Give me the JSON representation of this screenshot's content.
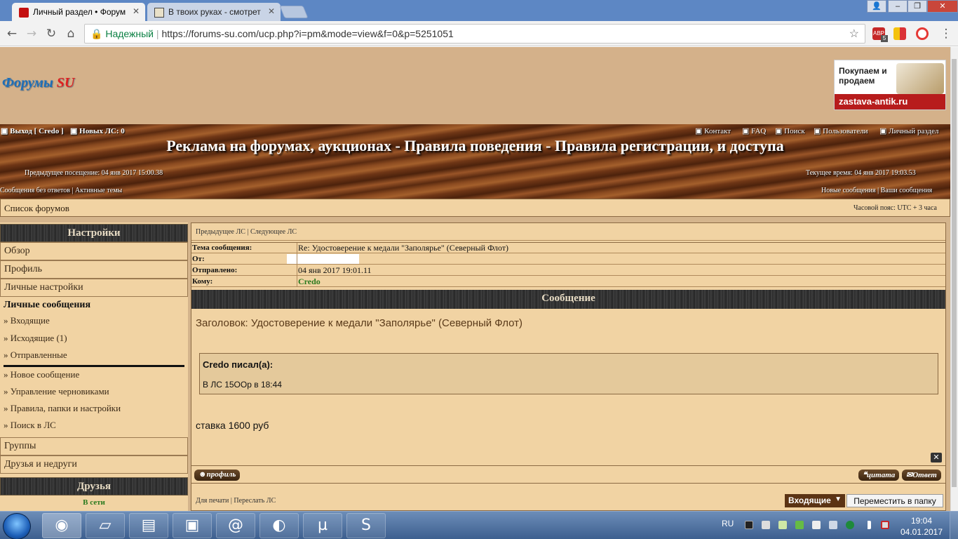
{
  "browser": {
    "tabs": [
      {
        "title": "Личный раздел • Форум"
      },
      {
        "title": "В твоих руках - смотрет"
      }
    ],
    "secure_label": "Надежный",
    "url": "https://forums-su.com/ucp.php?i=pm&mode=view&f=0&p=5251051",
    "abp_count": "5"
  },
  "header": {
    "logo_main": "Форумы",
    "logo_accent": "SU",
    "ad_text": "Покупаем и продаем",
    "ad_url": "zastava-antik.ru"
  },
  "topbar": {
    "logout": "Выход [ Credo ]",
    "new_pm": "Новых ЛС: 0",
    "links": [
      "Контакт",
      "FAQ",
      "Поиск",
      "Пользователи",
      "Личный раздел"
    ],
    "banner": "Реклама на форумах, аукционах - Правила поведения - Правила регистрации, и доступа",
    "last_visit": "Предыдущее посещение: 04 янв 2017 15:00.38",
    "current_time": "Текущее время: 04 янв 2017 19:03.53",
    "left_links": [
      "Сообщения без ответов",
      "Активные темы"
    ],
    "right_links": [
      "Новые сообщения",
      "Ваши сообщения"
    ]
  },
  "crumbbar": {
    "crumb": "Список форумов",
    "timezone": "Часовой пояс: UTC + 3 часа"
  },
  "sidebar": {
    "settings_title": "Настройки",
    "items": [
      "Обзор",
      "Профиль",
      "Личные настройки"
    ],
    "pm_title": "Личные сообщения",
    "pm_links": [
      "» Входящие",
      "» Исходящие (1)",
      "» Отправленные"
    ],
    "pm_actions": [
      "» Новое сообщение",
      "» Управление черновиками",
      "» Правила, папки и настройки",
      "» Поиск в ЛС"
    ],
    "groups": "Группы",
    "friends_foes": "Друзья и недруги",
    "friends_title": "Друзья",
    "online": "В сети"
  },
  "message": {
    "nav_prev": "Предыдущее ЛС",
    "nav_next": "Следующее ЛС",
    "fields": [
      {
        "label": "Тема сообщения:",
        "value": "Re: Удостоверение к медали \"Заполярье\" (Северный Флот)"
      },
      {
        "label": "От:",
        "value": ""
      },
      {
        "label": "Отправлено:",
        "value": "04 янв 2017 19:01.11"
      },
      {
        "label": "Кому:",
        "value": "Credo"
      }
    ],
    "section_title": "Сообщение",
    "subject": "Заголовок: Удостоверение к медали \"Заполярье\" (Северный Флот)",
    "quote_author": "Credo писал(а):",
    "quote_text": "В ЛС 15OOр в 18:44",
    "body": "ставка 1600 руб",
    "btn_profile": "профиль",
    "btn_quote": "цитата",
    "btn_reply": "Ответ",
    "print": "Для печати",
    "forward": "Переслать ЛС",
    "folder": "Входящие",
    "move": "Переместить в папку"
  },
  "taskbar": {
    "lang": "RU",
    "time": "19:04",
    "date": "04.01.2017"
  },
  "colors": {
    "accent_green": "#2a7a1e",
    "panel": "#f1d3a3",
    "header_bg": "#d4b18a"
  }
}
